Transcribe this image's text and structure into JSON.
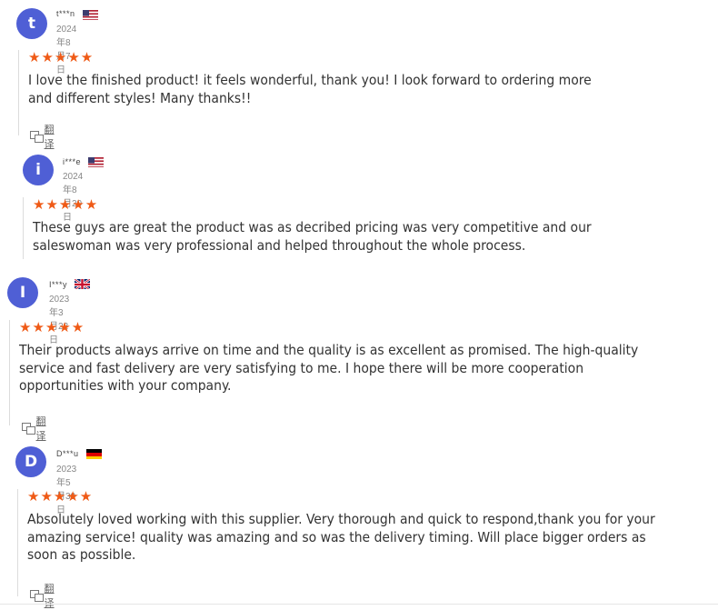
{
  "reviews": [
    {
      "initial": "t",
      "user": "t***n",
      "country_flag": "us-flag-icon",
      "date": "2024年8月7日",
      "stars": "★★★★★",
      "rating": 5,
      "text": "I love the finished product! it feels wonderful, thank you! I look forward to ordering more and different styles! Many thanks!!",
      "translate_label": "翻译"
    },
    {
      "initial": "i",
      "user": "i***e",
      "country_flag": "us-flag-icon",
      "date": "2024年8月20日",
      "stars": "★★★★★",
      "rating": 5,
      "text": "These guys are great the product was as decribed pricing was very competitive and our saleswoman was very professional and helped throughout the whole process."
    },
    {
      "initial": "I",
      "user": "I***y",
      "country_flag": "uk-flag-icon",
      "date": "2023年3月22日",
      "stars": "★★★★★",
      "rating": 5,
      "text": "Their products always arrive on time and the quality is as excellent as promised. The high-quality service and fast delivery are very satisfying to me. I hope there will be more cooperation opportunities with your company.",
      "translate_label": "翻译"
    },
    {
      "initial": "D",
      "user": "D***u",
      "country_flag": "de-flag-icon",
      "date": "2023年5月30日",
      "stars": "★★★★★",
      "rating": 5,
      "text": "Absolutely loved working with this supplier. Very thorough and quick to respond,thank you for your amazing service! quality was amazing and so was the delivery timing. Will place bigger orders as soon as possible.",
      "translate_label": "翻译"
    }
  ]
}
